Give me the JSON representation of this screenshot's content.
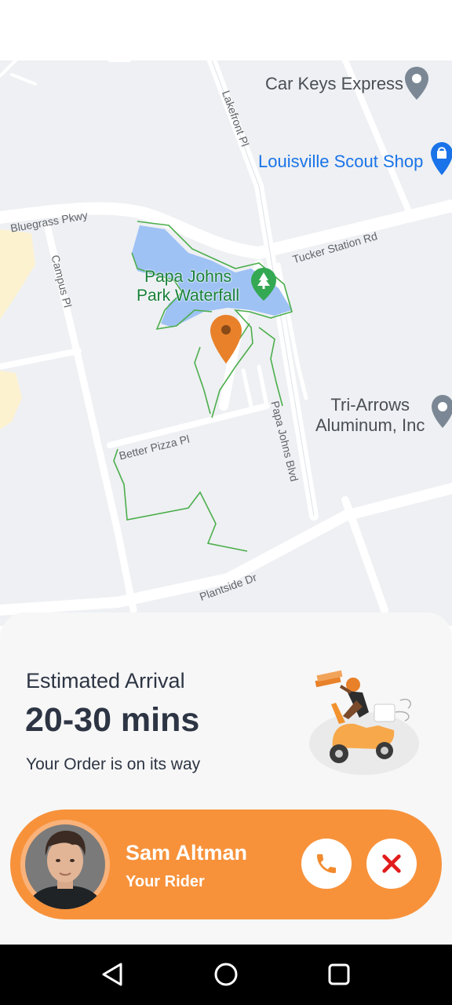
{
  "map": {
    "pois": {
      "car_keys": "Car Keys Express",
      "scout_shop": "Louisville Scout Shop",
      "park_line1": "Papa Johns",
      "park_line2": "Park Waterfall",
      "tri_arrows_line1": "Tri-Arrows",
      "tri_arrows_line2": "Aluminum, Inc"
    },
    "streets": {
      "lakefront": "Lakefront Pl",
      "bluegrass": "Bluegrass Pkwy",
      "tucker": "Tucker Station Rd",
      "campus": "Campus Pl",
      "better_pizza": "Better Pizza Pl",
      "papa_johns_blvd": "Papa Johns Blvd",
      "plantside": "Plantside Dr"
    },
    "pin_color": "#e8812a"
  },
  "order": {
    "eta_title": "Estimated Arrival",
    "eta_value": "20-30 mins",
    "status": "Your Order is on its way"
  },
  "rider": {
    "name": "Sam Altman",
    "role": "Your Rider",
    "card_color": "#f7923b"
  },
  "icons": {
    "call": "phone-icon",
    "cancel": "close-icon",
    "nav_back": "triangle-back-icon",
    "nav_home": "circle-home-icon",
    "nav_recents": "square-recents-icon"
  }
}
